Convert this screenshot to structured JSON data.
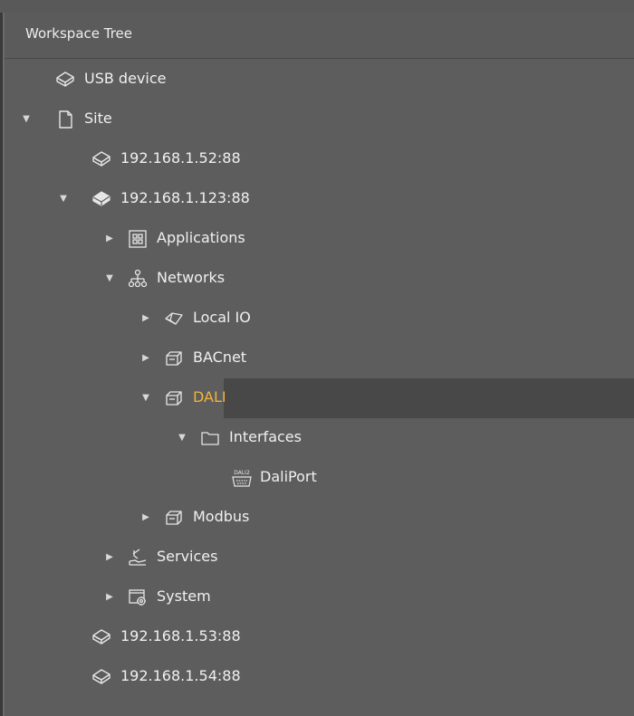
{
  "panel": {
    "title": "Workspace Tree"
  },
  "tree": {
    "usb_device": "USB device",
    "site": "Site",
    "device_52": "192.168.1.52:88",
    "device_123": "192.168.1.123:88",
    "applications": "Applications",
    "networks": "Networks",
    "local_io": "Local IO",
    "bacnet": "BACnet",
    "dali": "DALI",
    "interfaces": "Interfaces",
    "daliport": "DaliPort",
    "daliport_icon_text": "DALI2",
    "modbus": "Modbus",
    "services": "Services",
    "system": "System",
    "device_53": "192.168.1.53:88",
    "device_54": "192.168.1.54:88"
  },
  "colors": {
    "selected_label": "#f0b43a",
    "selected_row": "#484848",
    "background": "#5d5d5d"
  }
}
